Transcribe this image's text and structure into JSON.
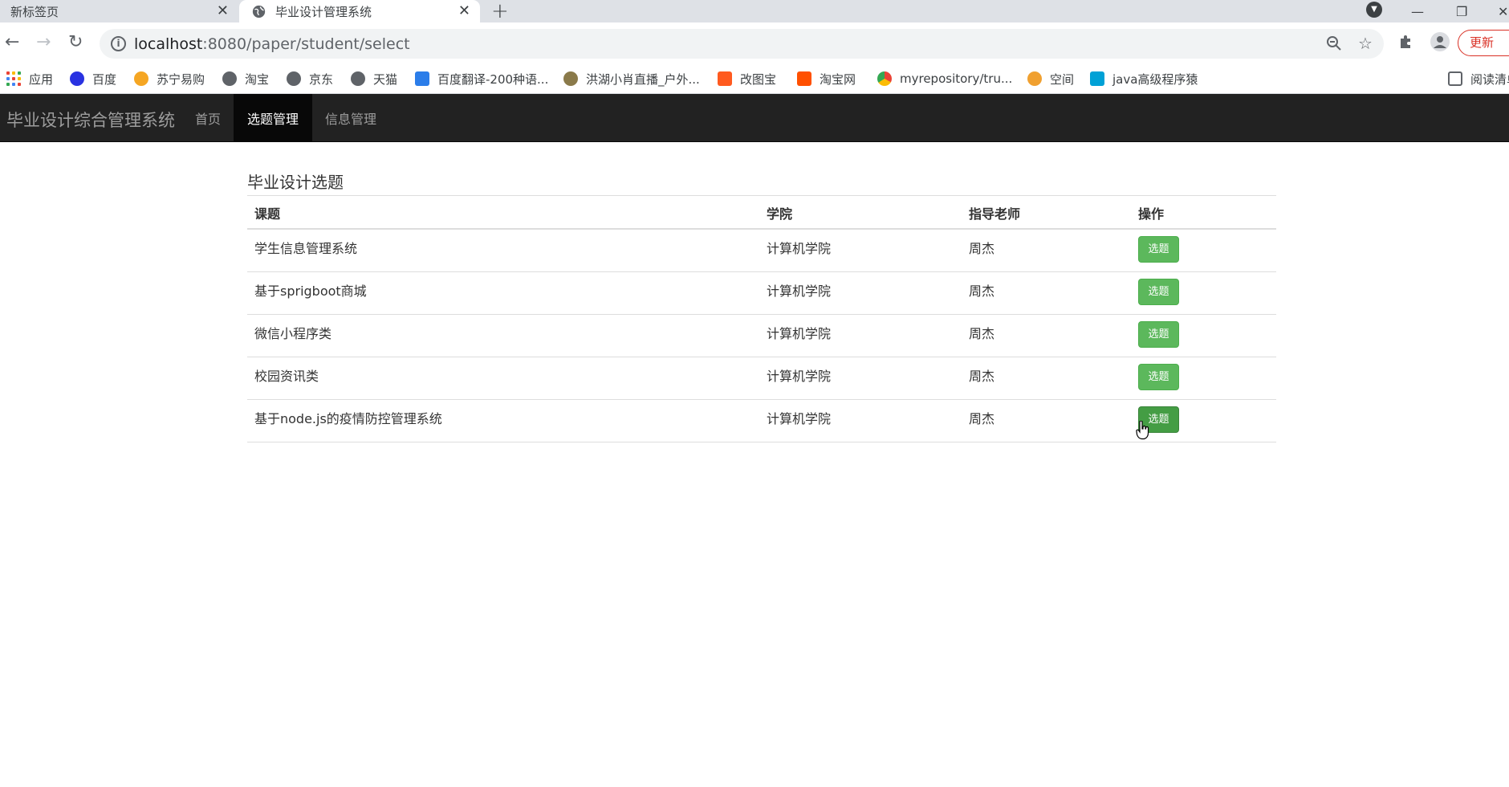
{
  "browser": {
    "tabs": [
      {
        "title": "新标签页",
        "active": false
      },
      {
        "title": "毕业设计管理系统",
        "active": true
      }
    ],
    "url_host": "localhost",
    "url_rest": ":8080/paper/student/select",
    "update_label": "更新",
    "bookmarks": [
      {
        "label": "应用",
        "icon": "apps-grid-icon"
      },
      {
        "label": "百度",
        "icon": "baidu-paw-icon",
        "color": "#2932e1"
      },
      {
        "label": "苏宁易购",
        "icon": "suning-icon",
        "color": "#f5a623"
      },
      {
        "label": "淘宝",
        "icon": "globe-icon",
        "color": "#5f6368"
      },
      {
        "label": "京东",
        "icon": "globe-icon",
        "color": "#5f6368"
      },
      {
        "label": "天猫",
        "icon": "globe-icon",
        "color": "#5f6368"
      },
      {
        "label": "百度翻译-200种语...",
        "icon": "translate-icon",
        "color": "#2b7de9"
      },
      {
        "label": "洪湖小肖直播_户外...",
        "icon": "bird-icon",
        "color": "#8a7a4a"
      },
      {
        "label": "改图宝",
        "icon": "gaitubao-icon",
        "color": "#ff5a1f"
      },
      {
        "label": "淘宝网",
        "icon": "taobao-icon",
        "color": "#ff5000"
      },
      {
        "label": "myrepository/tru...",
        "icon": "chrome-icon",
        "color": "#34a853"
      },
      {
        "label": "空间",
        "icon": "qzone-icon",
        "color": "#f0a030"
      },
      {
        "label": "java高级程序猿",
        "icon": "bilibili-icon",
        "color": "#00a1d6"
      }
    ],
    "reading_list_label": "阅读清单"
  },
  "navbar": {
    "brand": "毕业设计综合管理系统",
    "links": [
      {
        "label": "首页",
        "active": false
      },
      {
        "label": "选题管理",
        "active": true
      },
      {
        "label": "信息管理",
        "active": false
      }
    ]
  },
  "main": {
    "title": "毕业设计选题",
    "table": {
      "headers": [
        "课题",
        "学院",
        "指导老师",
        "操作"
      ],
      "rows": [
        {
          "topic": "学生信息管理系统",
          "college": "计算机学院",
          "teacher": "周杰",
          "action": "选题"
        },
        {
          "topic": "基于sprigboot商城",
          "college": "计算机学院",
          "teacher": "周杰",
          "action": "选题"
        },
        {
          "topic": "微信小程序类",
          "college": "计算机学院",
          "teacher": "周杰",
          "action": "选题"
        },
        {
          "topic": "校园资讯类",
          "college": "计算机学院",
          "teacher": "周杰",
          "action": "选题"
        },
        {
          "topic": "基于node.js的疫情防控管理系统",
          "college": "计算机学院",
          "teacher": "周杰",
          "action": "选题"
        }
      ]
    }
  },
  "colors": {
    "navbar_bg": "#222222",
    "navbar_active_bg": "#080808",
    "button_success": "#5cb85c",
    "button_success_hover": "#449d44"
  }
}
